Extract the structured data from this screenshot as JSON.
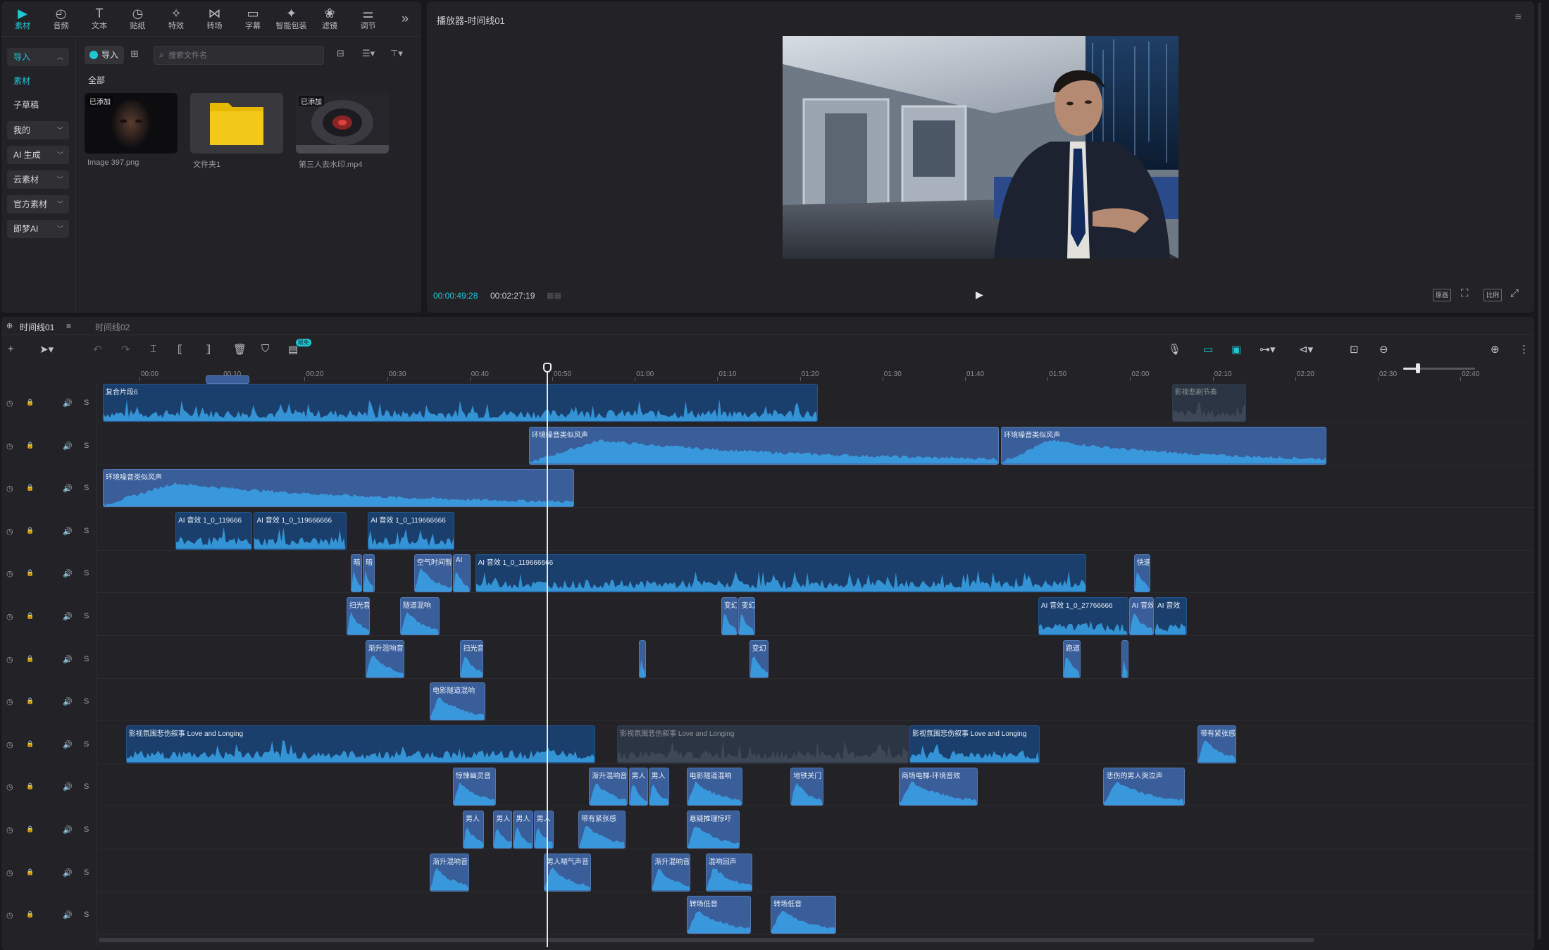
{
  "media": {
    "toolbar": [
      {
        "label": "素材",
        "icon": "media-icon"
      },
      {
        "label": "音频",
        "icon": "audio-icon"
      },
      {
        "label": "文本",
        "icon": "text-icon"
      },
      {
        "label": "贴纸",
        "icon": "sticker-icon"
      },
      {
        "label": "特效",
        "icon": "effects-icon"
      },
      {
        "label": "转场",
        "icon": "transition-icon"
      },
      {
        "label": "字幕",
        "icon": "caption-icon"
      },
      {
        "label": "智能包装",
        "icon": "smart-package-icon"
      },
      {
        "label": "滤镜",
        "icon": "filter-icon"
      },
      {
        "label": "调节",
        "icon": "adjust-icon"
      }
    ],
    "sidebar": [
      {
        "label": "导入",
        "style": "box-sel",
        "chev": "^"
      },
      {
        "label": "素材",
        "style": "sel",
        "chev": ""
      },
      {
        "label": "子草稿",
        "style": "",
        "chev": ""
      },
      {
        "label": "我的",
        "style": "box",
        "chev": "v"
      },
      {
        "label": "AI 生成",
        "style": "box",
        "chev": "v"
      },
      {
        "label": "云素材",
        "style": "box",
        "chev": "v"
      },
      {
        "label": "官方素材",
        "style": "box",
        "chev": "v"
      },
      {
        "label": "即梦AI",
        "style": "box",
        "chev": "v"
      }
    ],
    "import_label": "导入",
    "search_placeholder": "搜索文件名",
    "section_label": "全部",
    "files": [
      {
        "name": "Image 397.png",
        "tag": "已添加",
        "kind": "image"
      },
      {
        "name": "文件夹1",
        "tag": "",
        "kind": "folder"
      },
      {
        "name": "第三人去水印.mp4",
        "tag": "已添加",
        "kind": "video"
      }
    ]
  },
  "player": {
    "title": "播放器-时间线01",
    "current_time": "00:00:49:28",
    "total_time": "00:02:27:19",
    "controls": [
      "原画",
      "比例"
    ]
  },
  "timeline": {
    "tabs": [
      "时间线01",
      "时间线02"
    ],
    "badge": "限免",
    "ruler": [
      "00:00",
      "00:10",
      "00:20",
      "00:30",
      "00:40",
      "00:50",
      "01:00",
      "01:10",
      "01:20",
      "01:30",
      "01:40",
      "01:50",
      "02:00",
      "02:10",
      "02:20",
      "02:30",
      "02:40"
    ],
    "track_count": 13,
    "clips": [
      {
        "track": 0,
        "start": 0,
        "end": 86.6,
        "label": "复合片段6",
        "style": "dark"
      },
      {
        "track": 0,
        "start": 129.5,
        "end": 138.5,
        "label": "影视悲剧节奏",
        "style": "grey"
      },
      {
        "track": 1,
        "start": 51.6,
        "end": 108.5,
        "label": "环境噪音类似风声",
        "style": "light"
      },
      {
        "track": 1,
        "start": 108.8,
        "end": 148.2,
        "label": "环境噪音类似风声",
        "style": "light"
      },
      {
        "track": 2,
        "start": 0,
        "end": 57.1,
        "label": "环境噪音类似风声",
        "style": "light"
      },
      {
        "track": 3,
        "start": 8.8,
        "end": 18.1,
        "label": "AI 音效   1_0_119666",
        "style": "dark"
      },
      {
        "track": 3,
        "start": 18.3,
        "end": 29.5,
        "label": "AI 音效   1_0_119666666",
        "style": "dark"
      },
      {
        "track": 3,
        "start": 32.1,
        "end": 42.6,
        "label": "AI 音效   1_0_119666666",
        "style": "dark"
      },
      {
        "track": 4,
        "start": 30.0,
        "end": 31.4,
        "label": "暗",
        "style": "light"
      },
      {
        "track": 4,
        "start": 31.5,
        "end": 32.9,
        "label": "暗",
        "style": "light"
      },
      {
        "track": 4,
        "start": 37.7,
        "end": 42.3,
        "label": "空气时间暂",
        "style": "light"
      },
      {
        "track": 4,
        "start": 42.4,
        "end": 44.5,
        "label": "AI",
        "style": "light"
      },
      {
        "track": 4,
        "start": 45.1,
        "end": 119.1,
        "label": "AI 音效   1_0_119666666",
        "style": "dark"
      },
      {
        "track": 4,
        "start": 124.9,
        "end": 126.9,
        "label": "快速",
        "style": "light"
      },
      {
        "track": 5,
        "start": 29.5,
        "end": 32.3,
        "label": "扫光音",
        "style": "light"
      },
      {
        "track": 5,
        "start": 36.0,
        "end": 40.8,
        "label": "隧道混响",
        "style": "light"
      },
      {
        "track": 5,
        "start": 74.9,
        "end": 76.9,
        "label": "变幻",
        "style": "light"
      },
      {
        "track": 5,
        "start": 77.0,
        "end": 79.0,
        "label": "变幻",
        "style": "light"
      },
      {
        "track": 5,
        "start": 113.3,
        "end": 124.2,
        "label": "AI 音效   1_0_27766666",
        "style": "dark"
      },
      {
        "track": 5,
        "start": 124.3,
        "end": 127.3,
        "label": "AI 音效",
        "style": "light"
      },
      {
        "track": 5,
        "start": 127.4,
        "end": 131.3,
        "label": "AI 音效",
        "style": "dark"
      },
      {
        "track": 6,
        "start": 31.8,
        "end": 36.5,
        "label": "渐升混响音",
        "style": "light"
      },
      {
        "track": 6,
        "start": 43.3,
        "end": 46.1,
        "label": "扫光音",
        "style": "light"
      },
      {
        "track": 6,
        "start": 64.9,
        "end": 65.8,
        "label": "",
        "style": "light"
      },
      {
        "track": 6,
        "start": 78.3,
        "end": 80.6,
        "label": "变幻",
        "style": "light"
      },
      {
        "track": 6,
        "start": 116.3,
        "end": 118.4,
        "label": "跑道",
        "style": "light"
      },
      {
        "track": 6,
        "start": 123.4,
        "end": 124.2,
        "label": "",
        "style": "light"
      },
      {
        "track": 7,
        "start": 39.6,
        "end": 46.3,
        "label": "电影隧道混响",
        "style": "light"
      },
      {
        "track": 8,
        "start": 2.8,
        "end": 59.6,
        "label": "影视氛围悲伤叙事 Love and Longing",
        "style": "dark"
      },
      {
        "track": 8,
        "start": 62.3,
        "end": 97.6,
        "label": "影视氛围悲伤叙事 Love and Longing",
        "style": "grey"
      },
      {
        "track": 8,
        "start": 97.7,
        "end": 113.5,
        "label": "影视氛围悲伤叙事 Love and Longing",
        "style": "dark"
      },
      {
        "track": 8,
        "start": 132.6,
        "end": 137.3,
        "label": "带有紧张感",
        "style": "light"
      },
      {
        "track": 9,
        "start": 42.4,
        "end": 47.6,
        "label": "惊悚幽灵音",
        "style": "light"
      },
      {
        "track": 9,
        "start": 58.9,
        "end": 63.6,
        "label": "渐升混响音",
        "style": "light"
      },
      {
        "track": 9,
        "start": 63.7,
        "end": 66.0,
        "label": "男人",
        "style": "light"
      },
      {
        "track": 9,
        "start": 66.1,
        "end": 68.6,
        "label": "男人",
        "style": "light"
      },
      {
        "track": 9,
        "start": 70.7,
        "end": 77.5,
        "label": "电影隧道混响",
        "style": "light"
      },
      {
        "track": 9,
        "start": 83.3,
        "end": 87.3,
        "label": "地铁关门",
        "style": "light"
      },
      {
        "track": 9,
        "start": 96.4,
        "end": 106.0,
        "label": "商场电梯-环境音效",
        "style": "light"
      },
      {
        "track": 9,
        "start": 121.2,
        "end": 131.1,
        "label": "悲伤的男人哭泣声",
        "style": "light"
      },
      {
        "track": 10,
        "start": 43.6,
        "end": 46.2,
        "label": "男人",
        "style": "light"
      },
      {
        "track": 10,
        "start": 47.3,
        "end": 49.6,
        "label": "男人",
        "style": "light"
      },
      {
        "track": 10,
        "start": 49.7,
        "end": 52.1,
        "label": "男人",
        "style": "light"
      },
      {
        "track": 10,
        "start": 52.2,
        "end": 54.6,
        "label": "男人",
        "style": "light"
      },
      {
        "track": 10,
        "start": 57.6,
        "end": 63.3,
        "label": "带有紧张感",
        "style": "light"
      },
      {
        "track": 10,
        "start": 70.7,
        "end": 77.1,
        "label": "悬疑推理惊吓",
        "style": "light"
      },
      {
        "track": 11,
        "start": 39.6,
        "end": 44.4,
        "label": "渐升混响音",
        "style": "light"
      },
      {
        "track": 11,
        "start": 53.4,
        "end": 59.1,
        "label": "男人喘气声音",
        "style": "light"
      },
      {
        "track": 11,
        "start": 66.5,
        "end": 71.2,
        "label": "渐升混响音",
        "style": "light"
      },
      {
        "track": 11,
        "start": 73.0,
        "end": 78.7,
        "label": "混响回声",
        "style": "light"
      },
      {
        "track": 12,
        "start": 70.7,
        "end": 78.5,
        "label": "转场低音",
        "style": "light"
      },
      {
        "track": 12,
        "start": 80.9,
        "end": 88.8,
        "label": "转场低音",
        "style": "light"
      }
    ]
  }
}
